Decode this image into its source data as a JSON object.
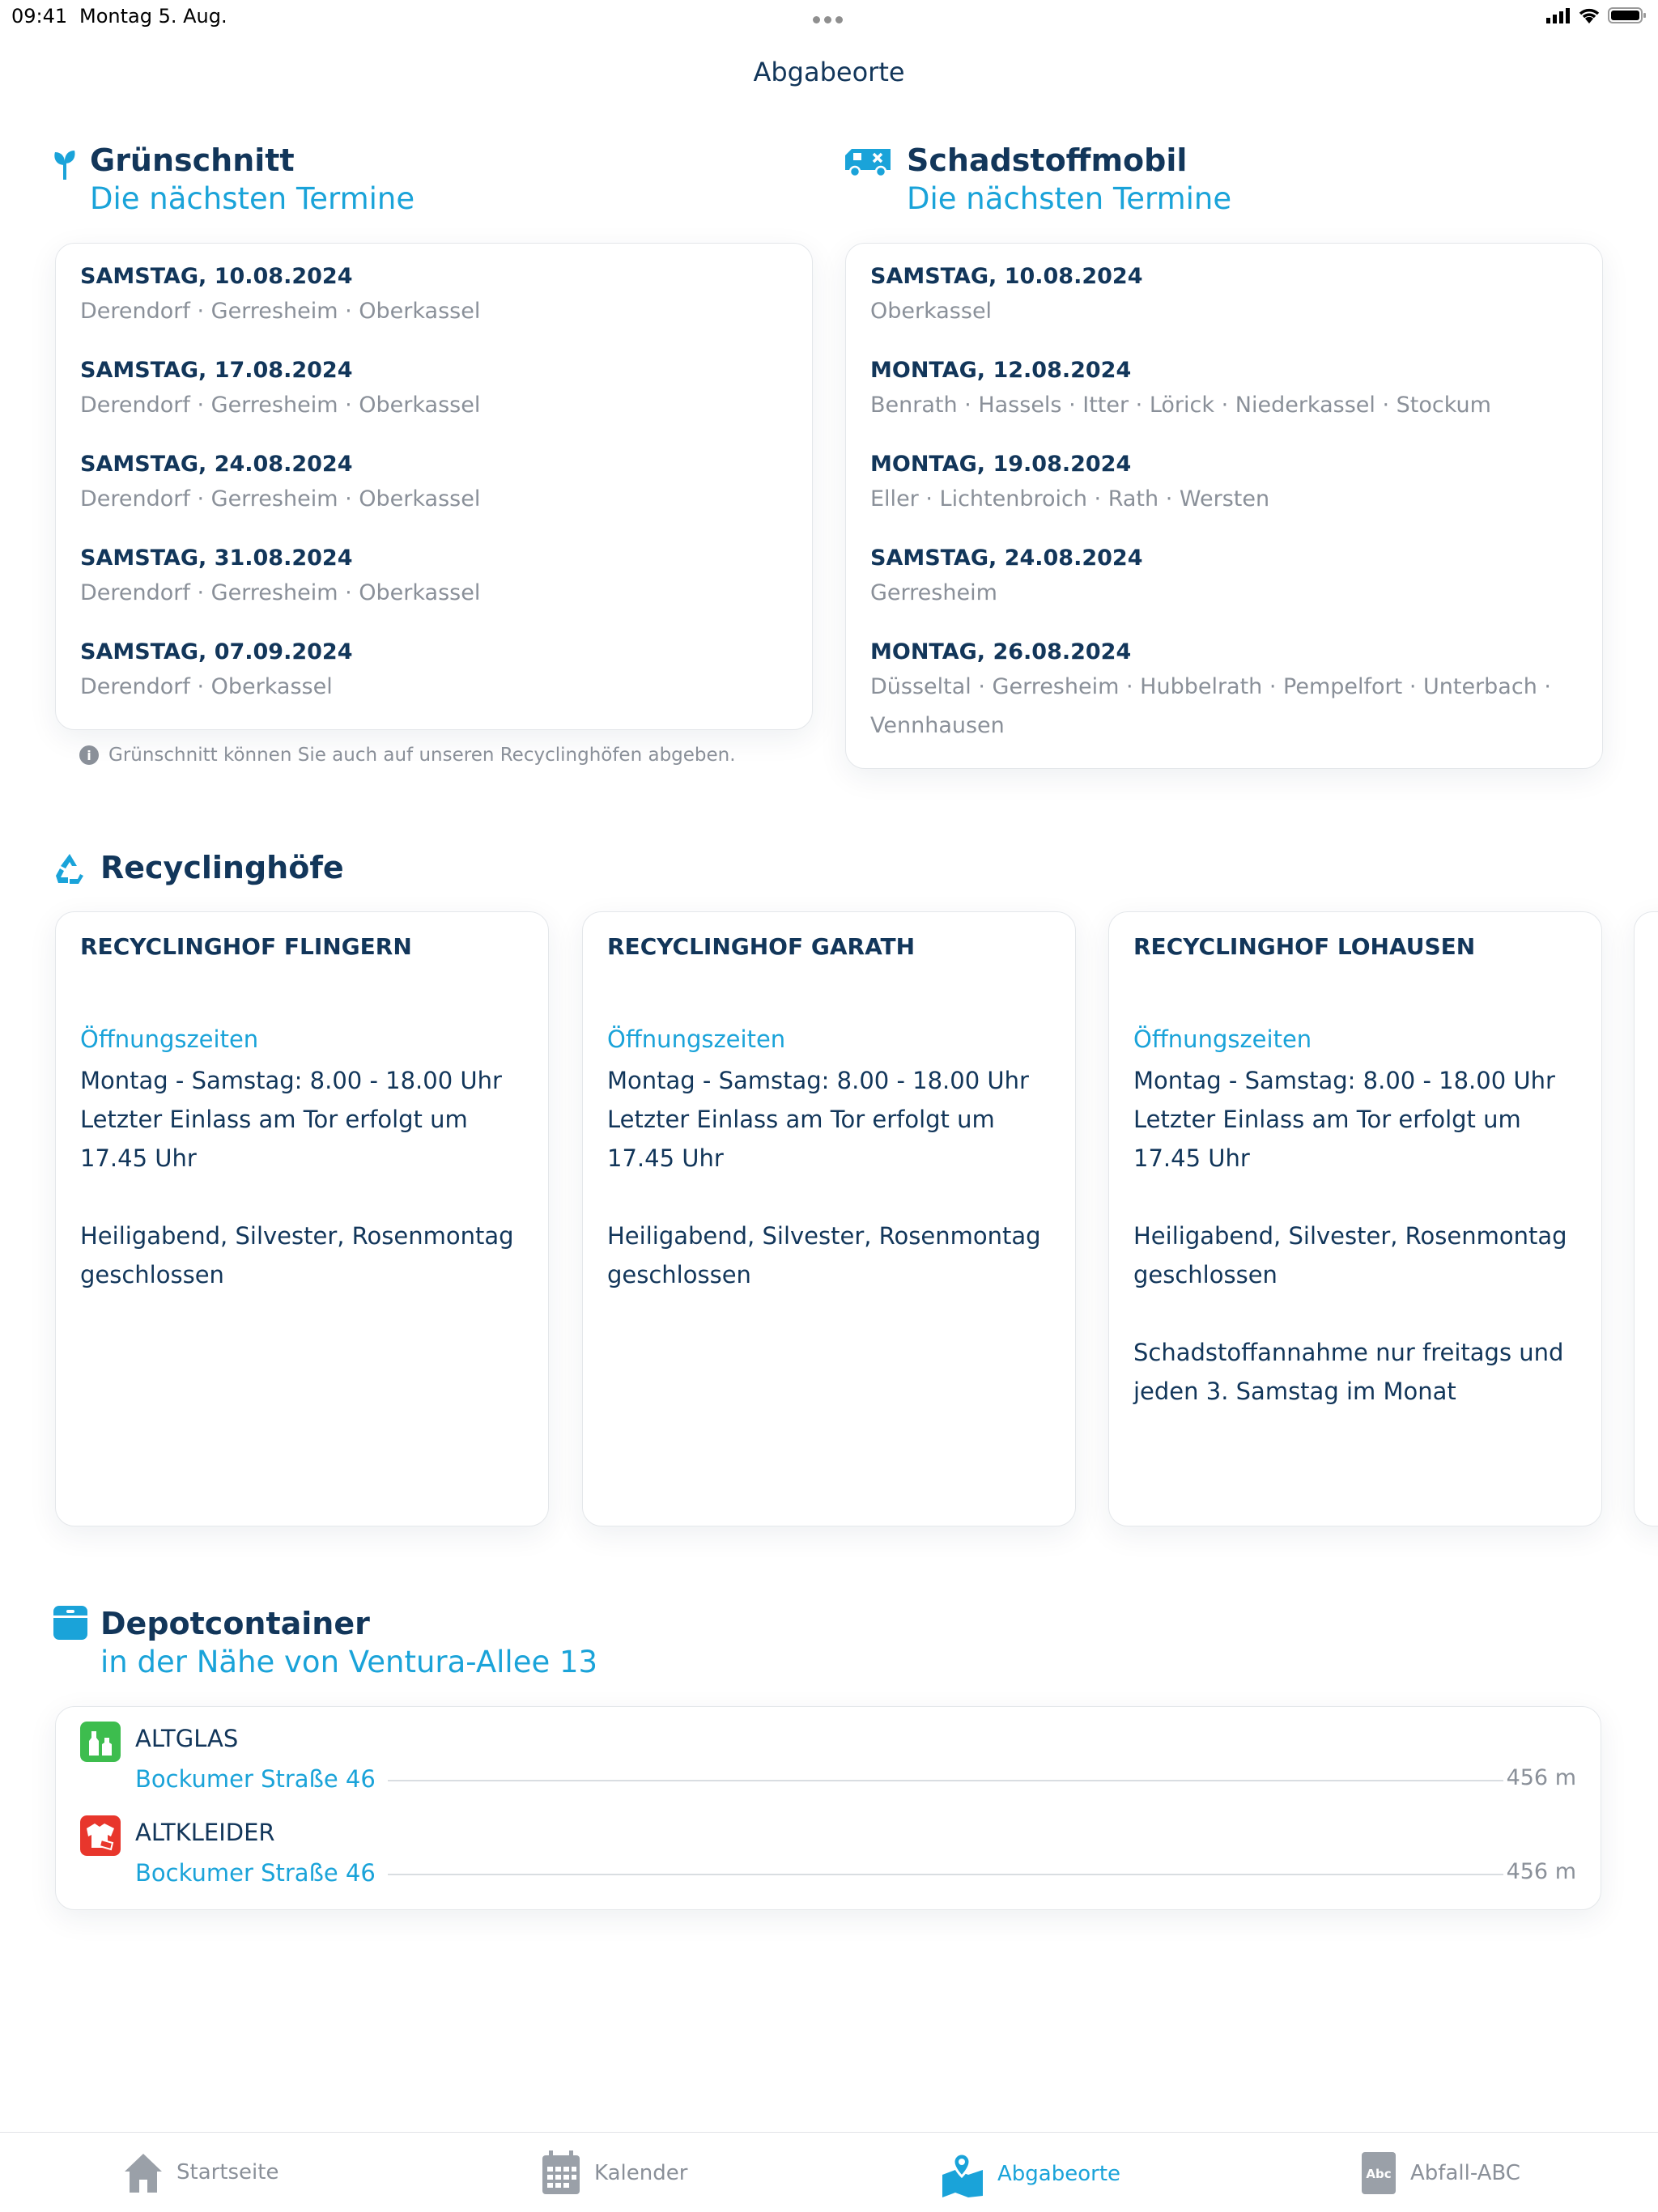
{
  "status": {
    "time": "09:41",
    "date": "Montag 5. Aug."
  },
  "header": {
    "title": "Abgabeorte"
  },
  "gruenschnitt": {
    "title": "Grünschnitt",
    "subtitle": "Die nächsten Termine",
    "entries": [
      {
        "date": "SAMSTAG, 10.08.2024",
        "places": "Derendorf · Gerresheim · Oberkassel"
      },
      {
        "date": "SAMSTAG, 17.08.2024",
        "places": "Derendorf · Gerresheim · Oberkassel"
      },
      {
        "date": "SAMSTAG, 24.08.2024",
        "places": "Derendorf · Gerresheim · Oberkassel"
      },
      {
        "date": "SAMSTAG, 31.08.2024",
        "places": "Derendorf · Gerresheim · Oberkassel"
      },
      {
        "date": "SAMSTAG, 07.09.2024",
        "places": "Derendorf · Oberkassel"
      }
    ],
    "note": "Grünschnitt können Sie auch auf unseren Recyclinghöfen abgeben."
  },
  "schadstoffmobil": {
    "title": "Schadstoffmobil",
    "subtitle": "Die nächsten Termine",
    "entries": [
      {
        "date": "SAMSTAG, 10.08.2024",
        "places": "Oberkassel"
      },
      {
        "date": "MONTAG, 12.08.2024",
        "places": "Benrath · Hassels · Itter · Lörick · Niederkassel · Stockum"
      },
      {
        "date": "MONTAG, 19.08.2024",
        "places": "Eller · Lichtenbroich · Rath · Wersten"
      },
      {
        "date": "SAMSTAG, 24.08.2024",
        "places": "Gerresheim"
      },
      {
        "date": "MONTAG, 26.08.2024",
        "places": "Düsseltal · Gerresheim · Hubbelrath · Pempelfort · Unterbach ·",
        "places2": "Vennhausen"
      }
    ]
  },
  "recyclinghoefe": {
    "title": "Recyclinghöfe",
    "cards": [
      {
        "name": "RECYCLINGHOF FLINGERN",
        "label": "Öffnungszeiten",
        "body": "Montag - Samstag: 8.00 - 18.00 Uhr\nLetzter Einlass am Tor erfolgt um 17.45 Uhr\n\nHeiligabend, Silvester, Rosenmontag geschlossen"
      },
      {
        "name": "RECYCLINGHOF GARATH",
        "label": "Öffnungszeiten",
        "body": "Montag - Samstag: 8.00 - 18.00 Uhr\nLetzter Einlass am Tor erfolgt um 17.45 Uhr\n\nHeiligabend, Silvester, Rosenmontag geschlossen"
      },
      {
        "name": "RECYCLINGHOF LOHAUSEN",
        "label": "Öffnungszeiten",
        "body": "Montag - Samstag: 8.00 - 18.00 Uhr\nLetzter Einlass am Tor erfolgt um 17.45 Uhr\n\nHeiligabend, Silvester, Rosenmontag geschlossen\n\nSchadstoffannahme nur freitags und jeden 3. Samstag im Monat"
      }
    ]
  },
  "depotcontainer": {
    "title": "Depotcontainer",
    "subtitle": "in der Nähe von Ventura-Allee 13",
    "items": [
      {
        "name": "ALTGLAS",
        "address": "Bockumer Straße 46",
        "distance": "456 m",
        "icon": "bottles-icon",
        "color": "#3dbd4e"
      },
      {
        "name": "ALTKLEIDER",
        "address": "Bockumer Straße 46",
        "distance": "456 m",
        "icon": "clothes-icon",
        "color": "#e8362c"
      }
    ]
  },
  "tabs": [
    {
      "label": "Startseite",
      "icon": "home-icon",
      "active": false
    },
    {
      "label": "Kalender",
      "icon": "calendar-icon",
      "active": false
    },
    {
      "label": "Abgabeorte",
      "icon": "map-pin-icon",
      "active": true
    },
    {
      "label": "Abfall-ABC",
      "icon": "abc-book-icon",
      "active": false
    }
  ],
  "colors": {
    "accent": "#1aa3d9",
    "navy": "#12365a",
    "muted": "#8a9099"
  }
}
